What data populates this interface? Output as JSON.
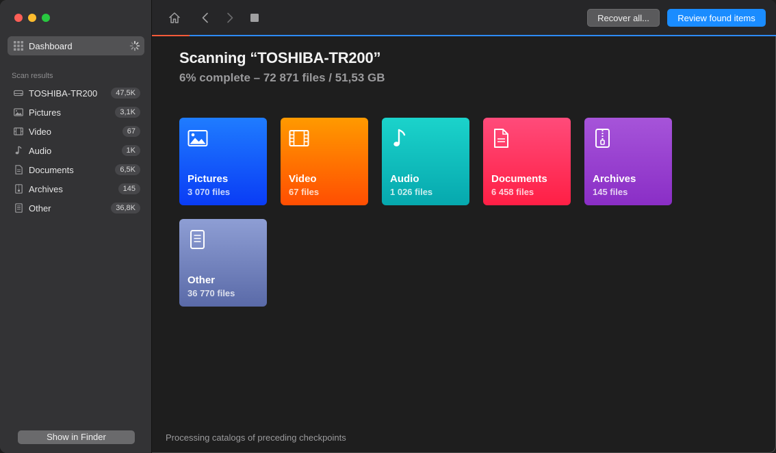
{
  "colors": {
    "accent": "#1a8cff",
    "progress_done": "#ff5b3a",
    "progress_track": "#2d8cff",
    "pictures": "#1f7cff",
    "video": "#ff7a00",
    "audio": "#12c1be",
    "documents": "#ff3360",
    "archives": "#9a41d0",
    "other": "#7383bd"
  },
  "sidebar": {
    "dashboard_label": "Dashboard",
    "section_title": "Scan results",
    "items": [
      {
        "label": "TOSHIBA-TR200",
        "count": "47,5K",
        "icon": "drive-icon"
      },
      {
        "label": "Pictures",
        "count": "3,1K",
        "icon": "picture-icon"
      },
      {
        "label": "Video",
        "count": "67",
        "icon": "film-icon"
      },
      {
        "label": "Audio",
        "count": "1K",
        "icon": "music-note-icon"
      },
      {
        "label": "Documents",
        "count": "6,5K",
        "icon": "document-icon"
      },
      {
        "label": "Archives",
        "count": "145",
        "icon": "archive-icon"
      },
      {
        "label": "Other",
        "count": "36,8K",
        "icon": "file-icon"
      }
    ],
    "finder_button": "Show in Finder"
  },
  "toolbar": {
    "recover_label": "Recover all...",
    "review_label": "Review found items",
    "progress": 0.06
  },
  "main": {
    "title": "Scanning “TOSHIBA-TR200”",
    "subtitle": "6% complete – 72 871 files / 51,53 GB",
    "tiles": [
      {
        "name": "Pictures",
        "count": "3 070 files",
        "icon": "picture-icon"
      },
      {
        "name": "Video",
        "count": "67 files",
        "icon": "film-icon"
      },
      {
        "name": "Audio",
        "count": "1 026 files",
        "icon": "music-note-icon"
      },
      {
        "name": "Documents",
        "count": "6 458 files",
        "icon": "document-icon"
      },
      {
        "name": "Archives",
        "count": "145 files",
        "icon": "archive-icon"
      },
      {
        "name": "Other",
        "count": "36 770 files",
        "icon": "file-icon"
      }
    ],
    "status": "Processing catalogs of preceding checkpoints"
  }
}
